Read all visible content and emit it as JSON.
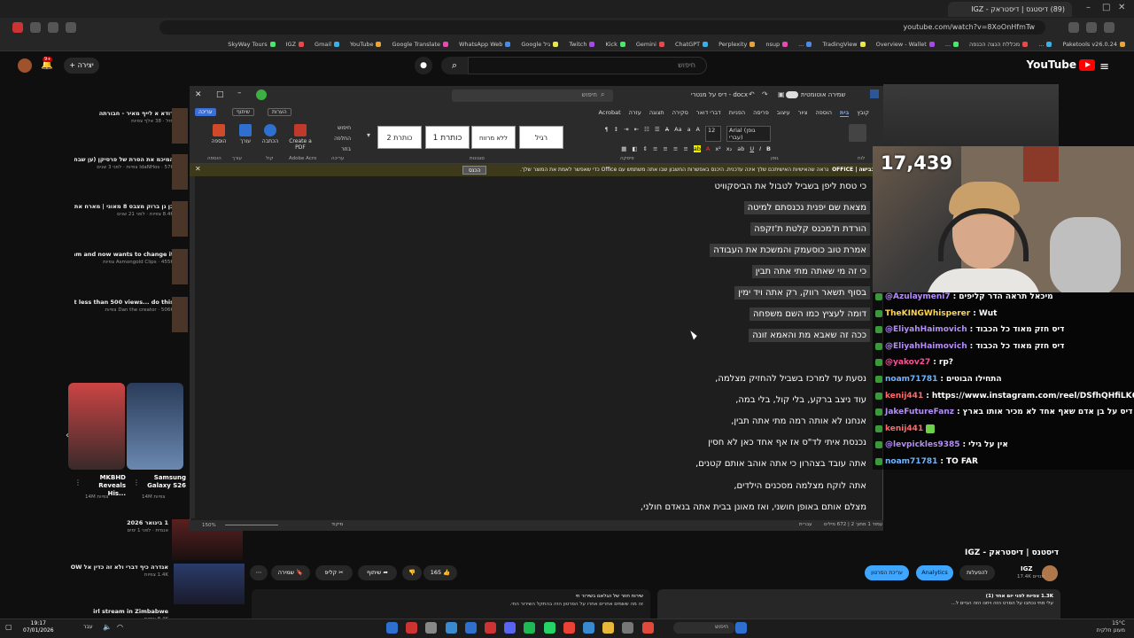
{
  "browser": {
    "tab_title": "(89) דיסטנס | דיסטראק - IGZ",
    "url": "youtube.com/watch?v=8XoOnHfmTw",
    "bookmarks": [
      "Paketools v26.0.24",
      "...",
      "מכללת הנצה הכנפה",
      "...",
      "Overview - Wallet",
      "TradingView",
      "...",
      "nsup",
      "Perplexity",
      "ChatGPT",
      "Gemini",
      "Kick",
      "Twitch",
      "Google גיל",
      "WhatsApp Web",
      "Google Translate",
      "YouTube",
      "Gmail",
      "IGZ",
      "SkyWay Tours"
    ]
  },
  "youtube": {
    "logo_text": "YouTube",
    "search_placeholder": "חיפוש",
    "create_label": "יצירה",
    "notification_count": "9+"
  },
  "recommendations": [
    {
      "title": "דודא א לייף מאיר - חבורתה",
      "meta": "מזל · 38 אלף צפיות"
    },
    {
      "title": "המיכמ את הסרת של פרסיקן (ען שבח)",
      "meta": "IdaNHos · 576 צפיות · לפני 3 שנים"
    },
    {
      "title": "בן גן ברוק מצבס 8 מאוני | מארח את אבי איזמרא #9",
      "meta": "8.4K צפיות · לפני 21 שנים"
    },
    {
      "title": "She converted to Islam and now wants to change it...",
      "meta": "Asmongold Clips · 455K צפיות"
    },
    {
      "title": "If your videos get less than 500 views... do this",
      "meta": "Dan the creator · 506K צפיות"
    }
  ],
  "shorts": [
    {
      "title": "Samsung Galaxy S26",
      "views": "14M צפיות"
    },
    {
      "title": "MKBHD Reveals His...",
      "views": "14M צפיות"
    }
  ],
  "rec_bottom": [
    {
      "title": "1 בינואר 2026",
      "meta": "אנמית · לפני 1 ימים"
    },
    {
      "title": "אנדרה כיף דברי ולא זה כדין אל SHON SHOW",
      "meta": "1.4K צפיות"
    },
    {
      "title": "irl stream in Zimbabwe",
      "meta": "8.4K צפיות"
    }
  ],
  "word": {
    "doc_name": "דיס על מנטרי - docx",
    "autosave": "שמירה אוטומטית",
    "search": "חיפוש",
    "tabs": [
      "קובץ",
      "בית",
      "הוספה",
      "ציור",
      "עיצוב",
      "פריסה",
      "הפניות",
      "דברי דואר",
      "סקירה",
      "תצוגה",
      "עזרה",
      "Acrobat"
    ],
    "active_tab": "בית",
    "editing": "עריכה",
    "share": "שיתוף",
    "comments": "הערות",
    "styles": [
      "רגיל",
      "ללא מרווח",
      "כותרת 1",
      "כותרת 2"
    ],
    "font_name": "Arial (גופן עברי)",
    "font_size": "12",
    "ribbon_groups": [
      "לוח",
      "גופן",
      "פיסקה",
      "סגנונות",
      "עריכה",
      "קול",
      "Adobe Acro",
      "עורך",
      "הוספה"
    ],
    "ribbon_buttons": [
      "הוספה",
      "עורך",
      "הכתבה",
      "Create a PDF",
      "חיפוש",
      "החלפה",
      "בחר"
    ],
    "infobar_title": "כבישה | OFFICE",
    "infobar_text": "נראה שהאישיות האישיתכם שלך אינה עדכנית. היכנס באפשרות החשבון שבו אתה משתמש עם Office כדי שאפשר לאמת את המוצר שלך.",
    "infobar_button": "הכנס",
    "lines": [
      {
        "text": "כי טסת ליפן בשביל לטבול את הביסקוויט",
        "hl": false
      },
      {
        "text": "מצאת שם יפנית נכנסתם למיטה",
        "hl": true
      },
      {
        "text": "הורדת ת'מכנס קלטת ת'זקפה",
        "hl": true
      },
      {
        "text": "אמרת טוב כוסעמק והמשכת את העבודה",
        "hl": true
      },
      {
        "text": "כי זה מי שאתה מתי אתה תבין",
        "hl": true
      },
      {
        "text": "בסוף תשאר רווק, רק אתה ויד ימין",
        "hl": true
      },
      {
        "text": "דומה לעציץ כמו השם משפחה",
        "hl": true
      },
      {
        "text": "ככה זה שאבא מת והאמא זונה",
        "hl": true
      },
      {
        "text": "נסעת עד למרכז בשביל להחזיק מצלמה,",
        "hl": false
      },
      {
        "text": "עוד ניצב ברקע, בלי קול, בלי במה,",
        "hl": false
      },
      {
        "text": "אנחנו לא אותה רמה מתי אתה תבין,",
        "hl": false
      },
      {
        "text": "נכנסת איתי לד\"ס אז אף אחד כאן לא חסין",
        "hl": false
      },
      {
        "text": "אתה עובד בצהרון כי אתה אוהב אותם קטנים,",
        "hl": false
      },
      {
        "text": "אתה לוקח מצלמה מסכנים הילדים,",
        "hl": false
      },
      {
        "text": "מצלם אותם באופן חושני, ואז מאונן בבית אתה בנאדם חולני,",
        "hl": false
      }
    ],
    "status_left": "עמוד 1 מתוך 2 | 672 מילים",
    "status_mid": "עברית",
    "status_right": "מיקוד",
    "zoom": "150%"
  },
  "stream": {
    "viewer_count": "17,439",
    "chat": [
      {
        "user": "@Azulaymeni7",
        "msg": "מיכאל תראה הדר קליפים",
        "color": "#b48ef7"
      },
      {
        "user": "TheKINGWhisperer",
        "msg": "Wut",
        "color": "#ffd54a"
      },
      {
        "user": "@EliyahHaimovich",
        "msg": "דיס חזק מאוד כל הכבוד",
        "color": "#b48ef7"
      },
      {
        "user": "@EliyahHaimovich",
        "msg": "דיס חזק מאוד כל הכבוד",
        "color": "#b48ef7"
      },
      {
        "user": "@yakov27",
        "msg": "rp?",
        "color": "#ff4f9a"
      },
      {
        "user": "noam71781",
        "msg": "התחילו הבוטים",
        "color": "#6fb4ff"
      },
      {
        "user": "kenij441",
        "msg": "https://www.instagram.com/reel/DSfhQHfiLK6",
        "color": "#ff6a6a"
      },
      {
        "user": "JakeFutureFanz",
        "msg": "דיס על בן אדם שאף אחד לא מכיר אותו בארץ",
        "color": "#b48ef7"
      },
      {
        "user": "kenij441",
        "msg": "",
        "color": "#ff6a6a"
      },
      {
        "user": "@levpickles9385",
        "msg": "אין על גילי",
        "color": "#b48ef7"
      },
      {
        "user": "noam71781",
        "msg": "TO FAR",
        "color": "#6fb4ff"
      }
    ]
  },
  "video": {
    "title": "דיסטנס | דיסטראק - IGZ",
    "channel": "IGZ",
    "subs": "17.4K מנויים",
    "edit_label": "להפעלות",
    "analytics_label": "Analytics",
    "edit_video_label": "עריכת הסרטון",
    "likes": "165",
    "share_label": "שיתוף",
    "clip_label": "קליפ",
    "save_label": "שמירה",
    "desc_views": "1.3K צפיות לפני יום אחד (1)",
    "desc_text": "עלי מחי נכתבו על הסרט הזה ויחנו הזה הביים ל...",
    "comment_text": "שירוח חוזר של הגלאם בשירור חי",
    "comment_sub": "זה מה ששמים אחרים אחרו על הסרטון הזה בהתקל השירור החי."
  },
  "taskbar": {
    "time": "19:17",
    "date": "07/01/2026",
    "search": "חיפוש",
    "weather": "15°C",
    "weather_desc": "מעונן חלקית",
    "lang": "עבר"
  }
}
